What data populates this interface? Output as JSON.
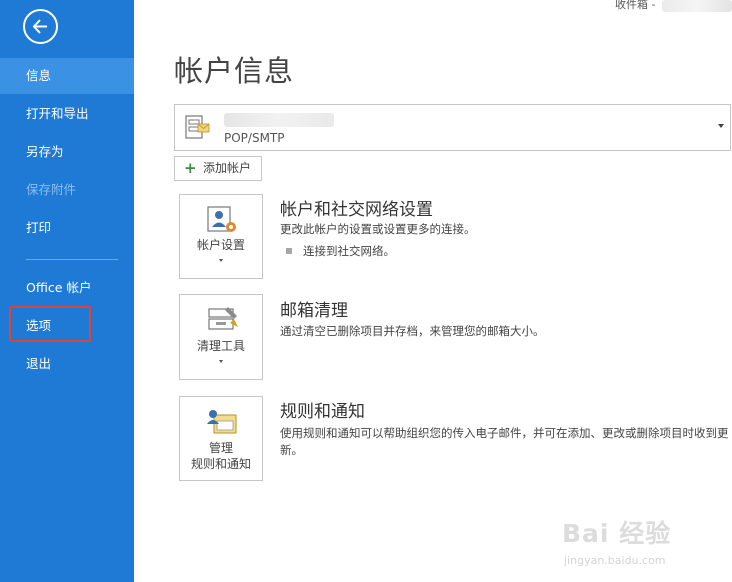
{
  "top_status": {
    "text": "收件箱 -"
  },
  "sidebar": {
    "back_label": "back",
    "items": [
      {
        "label": "信息"
      },
      {
        "label": "打开和导出"
      },
      {
        "label": "另存为"
      },
      {
        "label": "保存附件"
      },
      {
        "label": "打印"
      },
      {
        "label": "Office 帐户"
      },
      {
        "label": "选项"
      },
      {
        "label": "退出"
      }
    ]
  },
  "main": {
    "title": "帐户信息",
    "account": {
      "type": "POP/SMTP"
    },
    "add_account_label": "添加帐户",
    "sections": [
      {
        "tile_label": "帐户设置",
        "title": "帐户和社交网络设置",
        "description": "更改此帐户的设置或设置更多的连接。",
        "bullet": "连接到社交网络。"
      },
      {
        "tile_label": "清理工具",
        "title": "邮箱清理",
        "description": "通过清空已删除项目并存档，来管理您的邮箱大小。"
      },
      {
        "tile_label_line1": "管理",
        "tile_label_line2": "规则和通知",
        "title": "规则和通知",
        "description": "使用规则和通知可以帮助组织您的传入电子邮件，并可在添加、更改或删除项目时收到更新。"
      }
    ]
  },
  "watermark": {
    "main": "Bai 经验",
    "sub": "jingyan.baidu.com"
  },
  "colors": {
    "sidebar_bg": "#1e7ad4",
    "sidebar_active": "#3b91e3",
    "highlight": "#d9453c"
  },
  "icons": [
    "back-arrow-icon",
    "account-file-icon",
    "plus-icon",
    "account-settings-icon",
    "cleanup-tools-icon",
    "rules-alerts-icon",
    "dropdown-arrow-icon"
  ]
}
